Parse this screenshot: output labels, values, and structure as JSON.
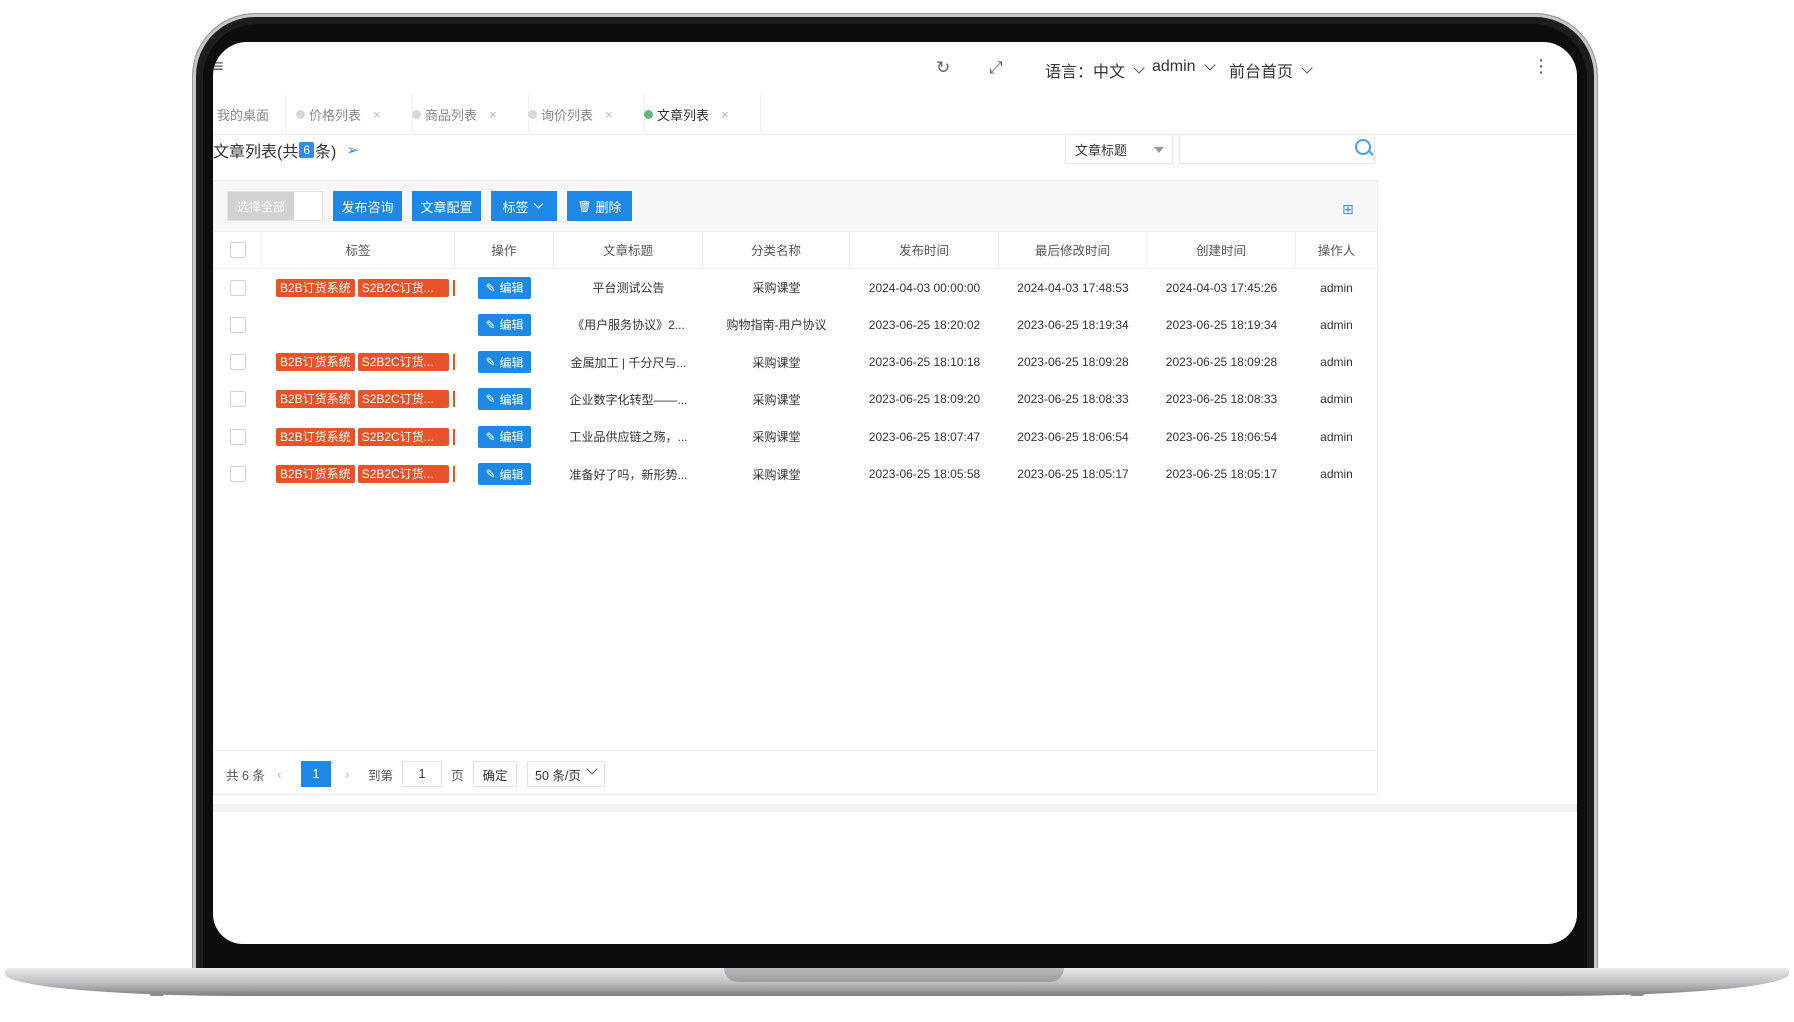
{
  "header": {
    "menu_icon": "menu-icon",
    "refresh_icon": "↻",
    "fullscreen_icon": "⤢",
    "language_label": "语言：中文",
    "user_label": "admin",
    "frontpage_label": "前台首页",
    "more_icon": "⋮"
  },
  "tabs": [
    {
      "label": "我的桌面",
      "dot": false,
      "active": false
    },
    {
      "label": "价格列表",
      "dot": true,
      "active": false
    },
    {
      "label": "商品列表",
      "dot": true,
      "active": false
    },
    {
      "label": "询价列表",
      "dot": true,
      "active": false
    },
    {
      "label": "文章列表",
      "dot": true,
      "active": true
    }
  ],
  "tab_close": "×",
  "page": {
    "title_prefix": "文章列表(共",
    "count": "6",
    "title_suffix": "条)",
    "send_icon": "send-icon"
  },
  "search": {
    "field_label": "文章标题",
    "placeholder": "",
    "value": ""
  },
  "toolbar": {
    "select_all": "选择全部",
    "publish": "发布咨询",
    "config": "文章配置",
    "tags": "标签",
    "delete": "删除",
    "delete_icon": "🗑",
    "grid_icon": "⊞"
  },
  "table": {
    "columns": [
      "标签",
      "操作",
      "文章标题",
      "分类名称",
      "发布时间",
      "最后修改时间",
      "创建时间",
      "操作人"
    ],
    "edit_label": "编辑",
    "edit_icon": "✎",
    "rows": [
      {
        "tags": [
          "B2B订货系统",
          "S2B2C订货..."
        ],
        "title": "平台测试公告",
        "category": "采购课堂",
        "publish": "2024-04-03 00:00:00",
        "modified": "2024-04-03 17:48:53",
        "created": "2024-04-03 17:45:26",
        "operator": "admin"
      },
      {
        "tags": [],
        "title": "《用户服务协议》2...",
        "category": "购物指南-用户协议",
        "publish": "2023-06-25 18:20:02",
        "modified": "2023-06-25 18:19:34",
        "created": "2023-06-25 18:19:34",
        "operator": "admin"
      },
      {
        "tags": [
          "B2B订货系统",
          "S2B2C订货..."
        ],
        "title": "金属加工 | 千分尺与...",
        "category": "采购课堂",
        "publish": "2023-06-25 18:10:18",
        "modified": "2023-06-25 18:09:28",
        "created": "2023-06-25 18:09:28",
        "operator": "admin"
      },
      {
        "tags": [
          "B2B订货系统",
          "S2B2C订货..."
        ],
        "title": "企业数字化转型——...",
        "category": "采购课堂",
        "publish": "2023-06-25 18:09:20",
        "modified": "2023-06-25 18:08:33",
        "created": "2023-06-25 18:08:33",
        "operator": "admin"
      },
      {
        "tags": [
          "B2B订货系统",
          "S2B2C订货..."
        ],
        "title": "工业品供应链之殇，...",
        "category": "采购课堂",
        "publish": "2023-06-25 18:07:47",
        "modified": "2023-06-25 18:06:54",
        "created": "2023-06-25 18:06:54",
        "operator": "admin"
      },
      {
        "tags": [
          "B2B订货系统",
          "S2B2C订货..."
        ],
        "title": "准备好了吗，新形势...",
        "category": "采购课堂",
        "publish": "2023-06-25 18:05:58",
        "modified": "2023-06-25 18:05:17",
        "created": "2023-06-25 18:05:17",
        "operator": "admin"
      }
    ]
  },
  "pagination": {
    "total": "共 6 条",
    "prev": "‹",
    "current": "1",
    "next": "›",
    "goto_label": "到第",
    "goto_value": "1",
    "page_unit": "页",
    "confirm": "确定",
    "page_size": "50 条/页"
  },
  "colors": {
    "primary": "#1e88e5",
    "tag": "#e8532a",
    "active_dot": "#5fb878"
  }
}
